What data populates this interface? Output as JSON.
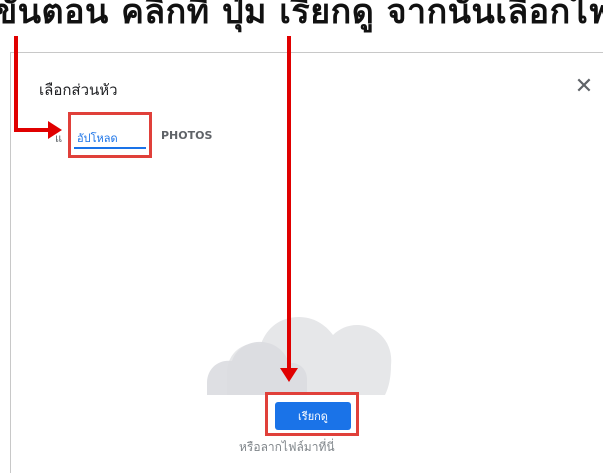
{
  "caption": "ขั้นตอน คลิกที่ ปุ่ม เรียกดู จากนั้นเลือกไฟล์ภาพที่อยู่ในเครื่อง",
  "dialog": {
    "title": "เลือกส่วนหัว",
    "close_symbol": "✕",
    "tabs": {
      "cut_tab_fragment": "แ",
      "upload": "อัปโหลด",
      "photos": "PHOTOS"
    },
    "browse_button": "เรียกดู",
    "drop_hint": "หรือลากไฟล์มาที่นี่"
  },
  "colors": {
    "accent": "#1a73e8",
    "annotation_red": "#e00000",
    "cloud": "#e6e7e9"
  },
  "icons": {
    "cloud": "cloud-upload-illustration",
    "close": "close-icon"
  }
}
